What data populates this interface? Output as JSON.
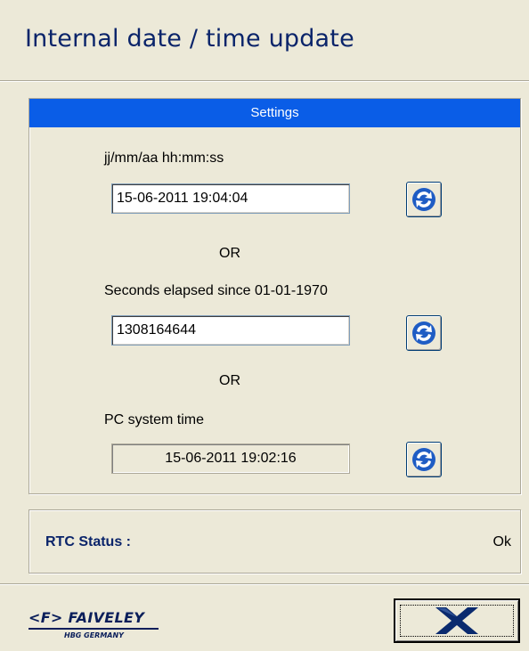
{
  "window": {
    "title": "Internal date / time update"
  },
  "settings": {
    "header": "Settings",
    "date_format_label": "jj/mm/aa hh:mm:ss",
    "date_value": "15-06-2011 19:04:04",
    "or_label_1": "OR",
    "seconds_label": "Seconds elapsed since 01-01-1970",
    "seconds_value": "1308164644",
    "or_label_2": "OR",
    "pc_time_label": "PC system time",
    "pc_time_value": "15-06-2011 19:02:16"
  },
  "status": {
    "label": "RTC Status :",
    "value": "Ok"
  },
  "logo": {
    "brand": "<F> FAIVELEY",
    "sub": "HBG GERMANY"
  },
  "colors": {
    "header_bg": "#0a5de7",
    "title_text": "#0a246a",
    "refresh_icon": "#1e5cc4"
  },
  "icons": {
    "refresh": "refresh-icon",
    "close": "close-icon"
  }
}
